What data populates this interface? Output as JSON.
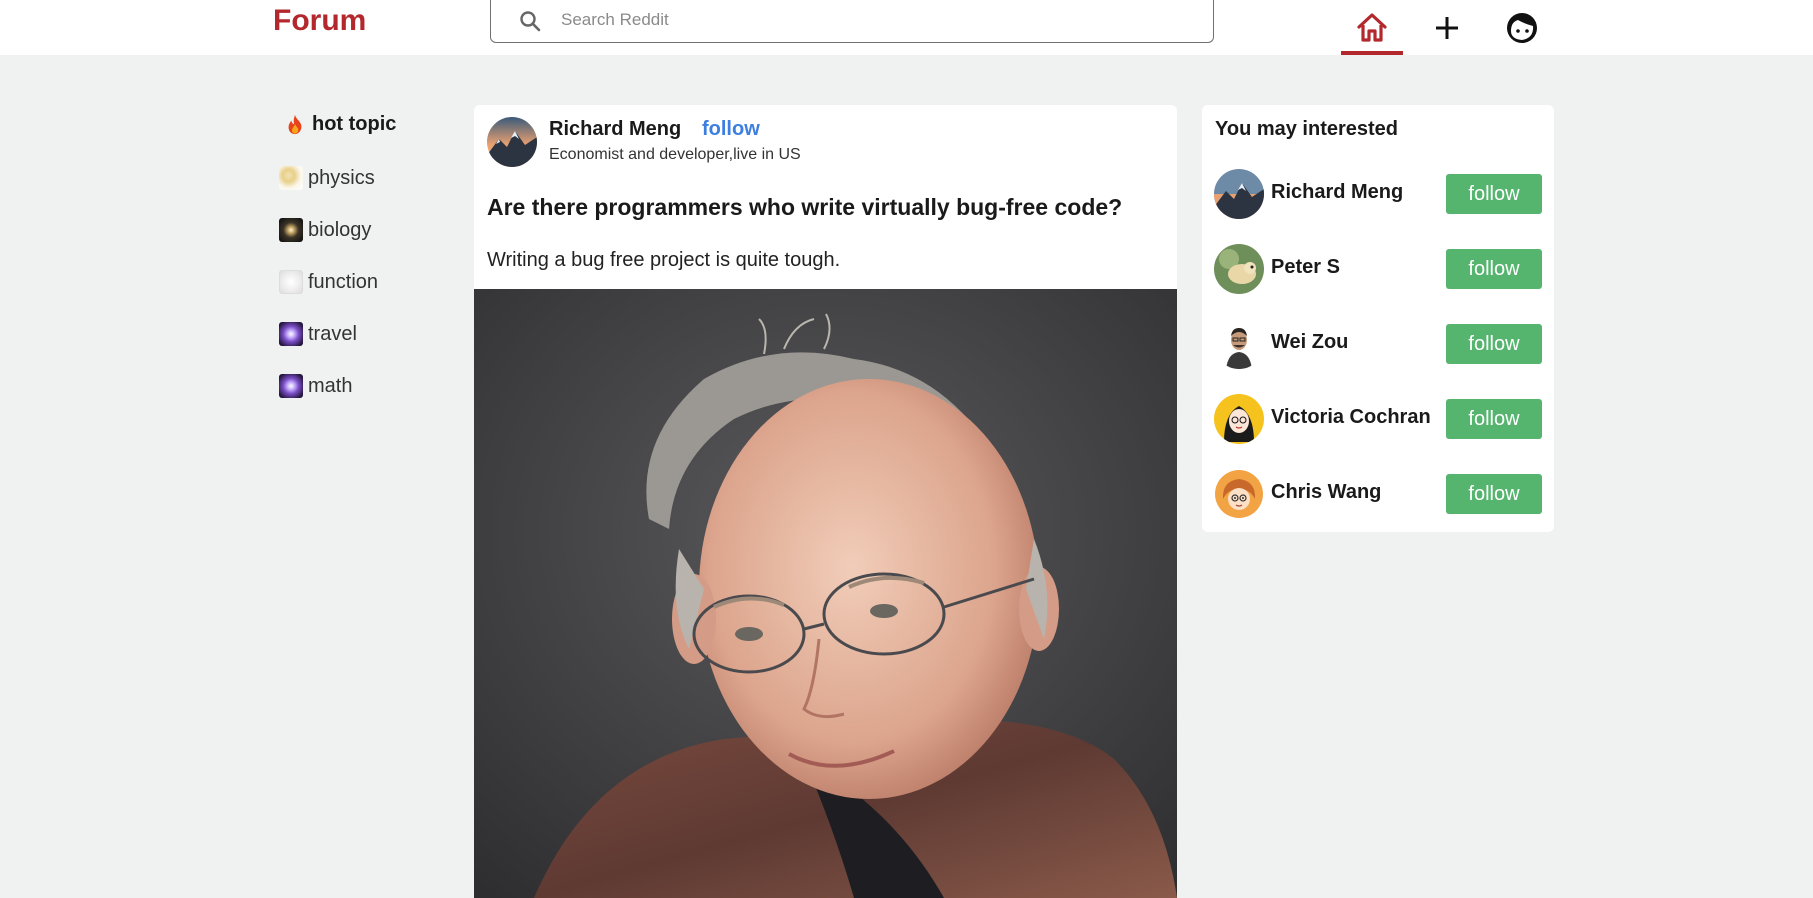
{
  "app": {
    "name": "Forum"
  },
  "search": {
    "placeholder": "Search Reddit"
  },
  "colors": {
    "brand": "#b3282d",
    "follow_link": "#3d7fe0",
    "follow_button": "#55b56f",
    "background": "#f0f2f1"
  },
  "nav": {
    "items": [
      {
        "icon": "home-icon",
        "active": true
      },
      {
        "icon": "plus-icon",
        "active": false
      },
      {
        "icon": "profile-face-icon",
        "active": false
      }
    ]
  },
  "sidebar": {
    "items": [
      {
        "label": "hot topic",
        "icon": "fire-icon"
      },
      {
        "label": "physics",
        "icon": "physics-thumbnail"
      },
      {
        "label": "biology",
        "icon": "galaxy-thumbnail"
      },
      {
        "label": "function",
        "icon": "function-thumbnail"
      },
      {
        "label": "travel",
        "icon": "nebula-thumbnail"
      },
      {
        "label": "math",
        "icon": "nebula-thumbnail"
      }
    ]
  },
  "post": {
    "author": "Richard Meng",
    "follow_label": "follow",
    "bio": "Economist and developer,live in US",
    "title": "Are there programmers who write virtually bug-free code?",
    "body": "Writing a bug free project is quite tough.",
    "image": "portrait-photo"
  },
  "suggestions": {
    "title": "You may interested",
    "button_label": "follow",
    "users": [
      {
        "name": "Richard Meng"
      },
      {
        "name": "Peter S"
      },
      {
        "name": "Wei Zou"
      },
      {
        "name": "Victoria Cochran"
      },
      {
        "name": "Chris Wang"
      }
    ]
  }
}
